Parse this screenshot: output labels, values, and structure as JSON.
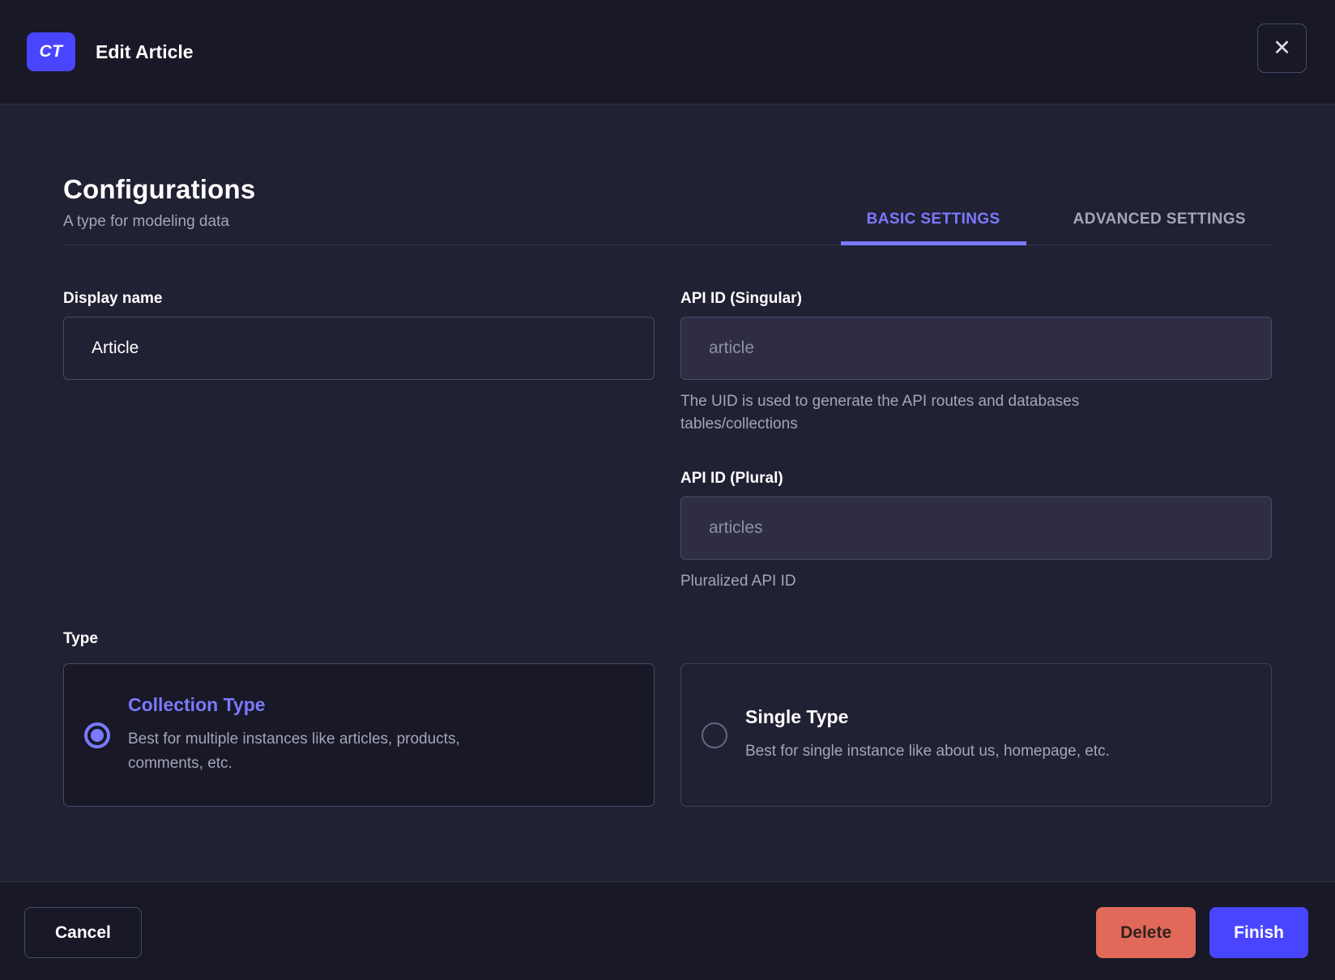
{
  "modal": {
    "badge": "CT",
    "title": "Edit Article",
    "close_glyph": "✕"
  },
  "heading": {
    "title": "Configurations",
    "subtitle": "A type for modeling data"
  },
  "tabs": [
    {
      "label": "BASIC SETTINGS",
      "active": true
    },
    {
      "label": "ADVANCED SETTINGS",
      "active": false
    }
  ],
  "form": {
    "display_name": {
      "label": "Display name",
      "value": "Article"
    },
    "api_id_singular": {
      "label": "API ID (Singular)",
      "value": "article",
      "help": "The UID is used to generate the API routes and databases tables/collections"
    },
    "api_id_plural": {
      "label": "API ID (Plural)",
      "value": "articles",
      "help": "Pluralized API ID"
    },
    "type": {
      "label": "Type",
      "options": [
        {
          "title": "Collection Type",
          "description": "Best for multiple instances like articles, products, comments, etc.",
          "selected": true
        },
        {
          "title": "Single Type",
          "description": "Best for single instance like about us, homepage, etc.",
          "selected": false
        }
      ]
    }
  },
  "footer": {
    "cancel_label": "Cancel",
    "delete_label": "Delete",
    "finish_label": "Finish"
  },
  "colors": {
    "accent": "#4945ff",
    "accent_light": "#7b79ff",
    "danger": "#e0695a",
    "header_bg": "#181826",
    "body_bg": "#212134",
    "muted_text": "#a5a5ba",
    "input_border": "#4a4a6a",
    "disabled_input_bg": "#2e2d44"
  }
}
